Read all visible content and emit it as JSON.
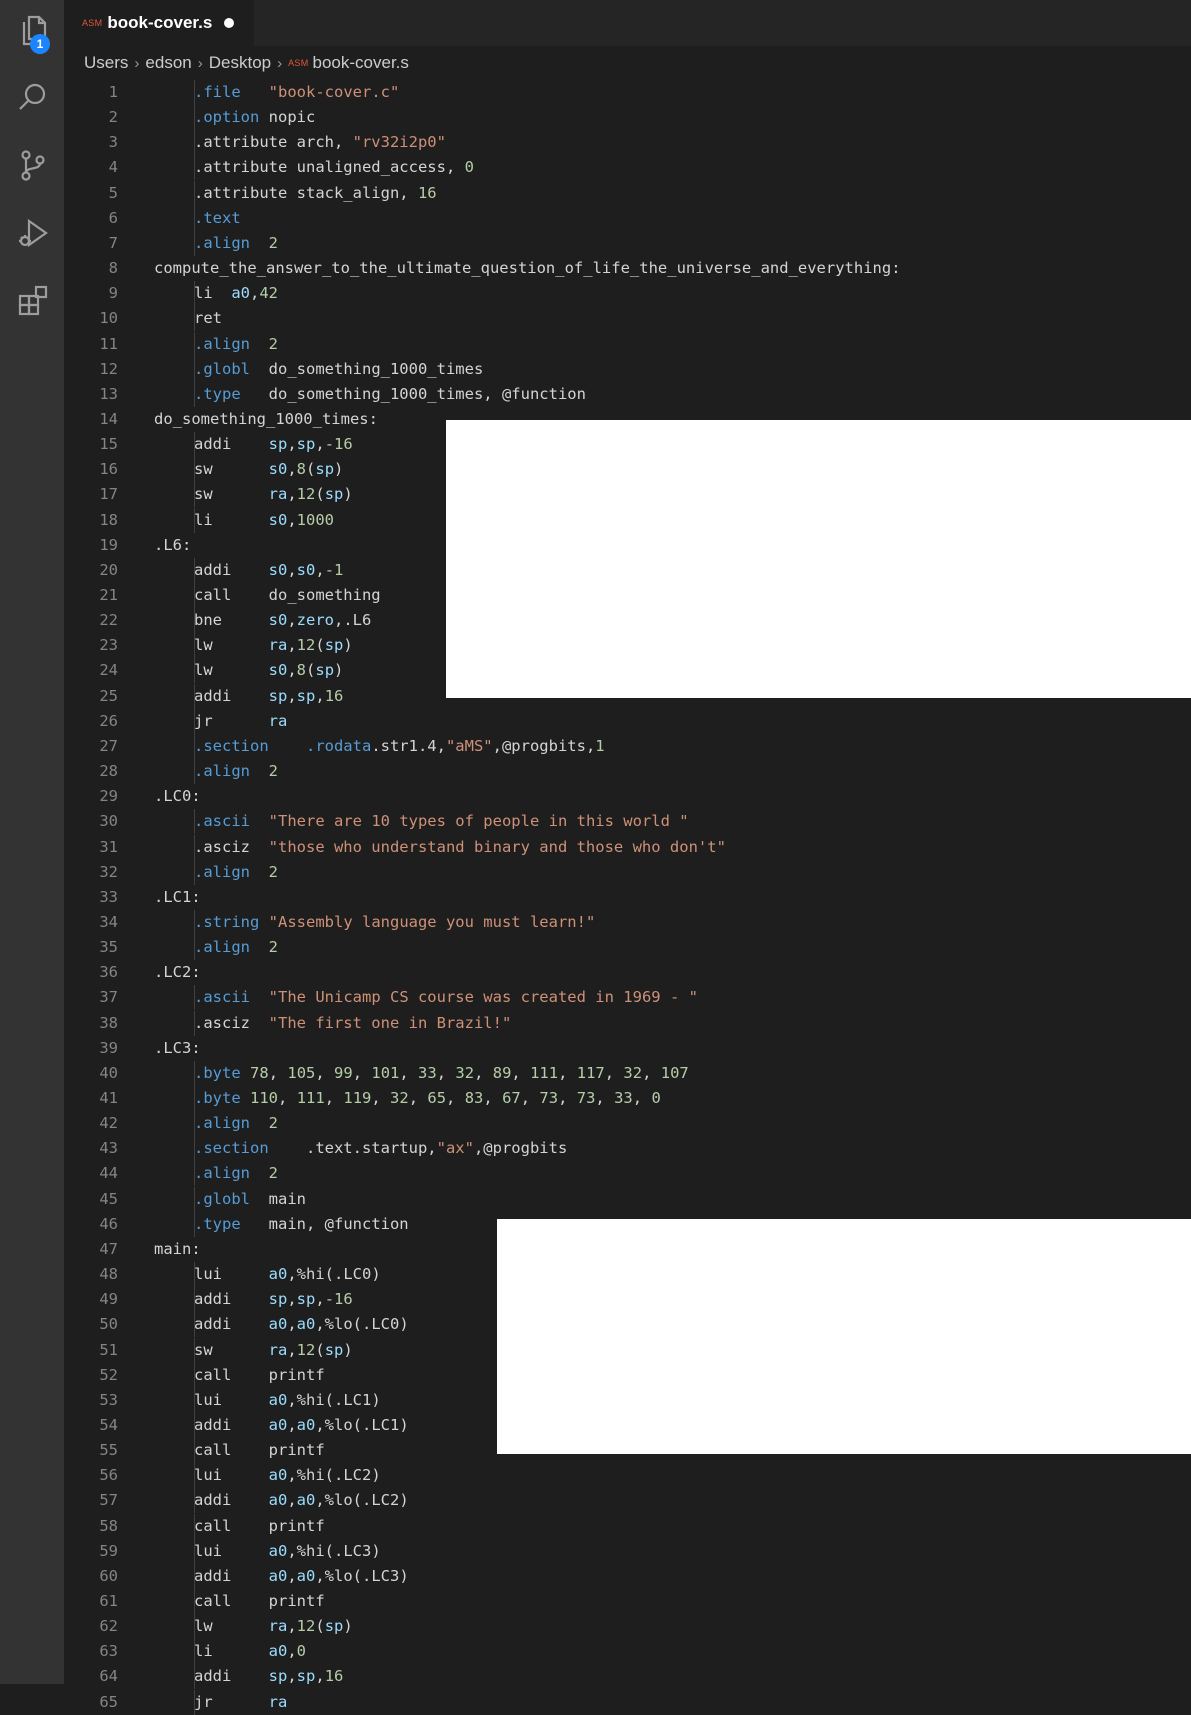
{
  "activity_bar": {
    "icons": [
      "files-icon",
      "search-icon",
      "source-control-icon",
      "run-debug-icon",
      "extensions-icon"
    ],
    "explorer_badge": "1"
  },
  "tab": {
    "language_badge": "ASM",
    "title": "book-cover.s",
    "dirty": true
  },
  "breadcrumb": [
    "Users",
    "edson",
    "Desktop",
    "book-cover.s"
  ],
  "colors": {
    "background": "#1e1e1e",
    "directive": "#569cd6",
    "string": "#ce9178",
    "number": "#b5cea8",
    "register": "#9cdcfe",
    "line_number": "#858585"
  },
  "lines": [
    {
      "n": "1",
      "i": 1,
      "tokens": [
        [
          ".file",
          "dir"
        ],
        [
          "   ",
          "txt"
        ],
        [
          "\"book-cover.c\"",
          "str"
        ]
      ]
    },
    {
      "n": "2",
      "i": 1,
      "tokens": [
        [
          ".option",
          "dir"
        ],
        [
          " nopic",
          "txt"
        ]
      ]
    },
    {
      "n": "3",
      "i": 1,
      "tokens": [
        [
          ".attribute arch, ",
          "txt"
        ],
        [
          "\"rv32i2p0\"",
          "str"
        ]
      ]
    },
    {
      "n": "4",
      "i": 1,
      "tokens": [
        [
          ".attribute unaligned_access, ",
          "txt"
        ],
        [
          "0",
          "num"
        ]
      ]
    },
    {
      "n": "5",
      "i": 1,
      "tokens": [
        [
          ".attribute stack_align, ",
          "txt"
        ],
        [
          "16",
          "num"
        ]
      ]
    },
    {
      "n": "6",
      "i": 1,
      "tokens": [
        [
          ".text",
          "dir"
        ]
      ]
    },
    {
      "n": "7",
      "i": 1,
      "tokens": [
        [
          ".align",
          "dir"
        ],
        [
          "  ",
          "txt"
        ],
        [
          "2",
          "num"
        ]
      ]
    },
    {
      "n": "8",
      "i": 0,
      "tokens": [
        [
          "compute_the_answer_to_the_ultimate_question_of_life_the_universe_and_everything:",
          "txt"
        ]
      ]
    },
    {
      "n": "9",
      "i": 1,
      "tokens": [
        [
          "li  ",
          "txt"
        ],
        [
          "a0",
          "reg"
        ],
        [
          ",",
          "txt"
        ],
        [
          "42",
          "num"
        ]
      ]
    },
    {
      "n": "10",
      "i": 1,
      "tokens": [
        [
          "ret",
          "txt"
        ]
      ]
    },
    {
      "n": "11",
      "i": 1,
      "tokens": [
        [
          ".align",
          "dir"
        ],
        [
          "  ",
          "txt"
        ],
        [
          "2",
          "num"
        ]
      ]
    },
    {
      "n": "12",
      "i": 1,
      "tokens": [
        [
          ".globl",
          "dir"
        ],
        [
          "  do_something_1000_times",
          "txt"
        ]
      ]
    },
    {
      "n": "13",
      "i": 1,
      "tokens": [
        [
          ".type",
          "dir"
        ],
        [
          "   do_something_1000_times, @function",
          "txt"
        ]
      ]
    },
    {
      "n": "14",
      "i": 0,
      "tokens": [
        [
          "do_something_1000_times:",
          "txt"
        ]
      ]
    },
    {
      "n": "15",
      "i": 1,
      "tokens": [
        [
          "addi    ",
          "txt"
        ],
        [
          "sp",
          "reg"
        ],
        [
          ",",
          "txt"
        ],
        [
          "sp",
          "reg"
        ],
        [
          ",",
          "txt"
        ],
        [
          "-16",
          "num"
        ]
      ]
    },
    {
      "n": "16",
      "i": 1,
      "tokens": [
        [
          "sw      ",
          "txt"
        ],
        [
          "s0",
          "reg"
        ],
        [
          ",",
          "txt"
        ],
        [
          "8",
          "num"
        ],
        [
          "(",
          "txt"
        ],
        [
          "sp",
          "reg"
        ],
        [
          ")",
          "txt"
        ]
      ]
    },
    {
      "n": "17",
      "i": 1,
      "tokens": [
        [
          "sw      ",
          "txt"
        ],
        [
          "ra",
          "reg"
        ],
        [
          ",",
          "txt"
        ],
        [
          "12",
          "num"
        ],
        [
          "(",
          "txt"
        ],
        [
          "sp",
          "reg"
        ],
        [
          ")",
          "txt"
        ]
      ]
    },
    {
      "n": "18",
      "i": 1,
      "tokens": [
        [
          "li      ",
          "txt"
        ],
        [
          "s0",
          "reg"
        ],
        [
          ",",
          "txt"
        ],
        [
          "1000",
          "num"
        ]
      ]
    },
    {
      "n": "19",
      "i": 0,
      "tokens": [
        [
          ".L6:",
          "txt"
        ]
      ]
    },
    {
      "n": "20",
      "i": 1,
      "tokens": [
        [
          "addi    ",
          "txt"
        ],
        [
          "s0",
          "reg"
        ],
        [
          ",",
          "txt"
        ],
        [
          "s0",
          "reg"
        ],
        [
          ",",
          "txt"
        ],
        [
          "-1",
          "num"
        ]
      ]
    },
    {
      "n": "21",
      "i": 1,
      "tokens": [
        [
          "call    do_something",
          "txt"
        ]
      ]
    },
    {
      "n": "22",
      "i": 1,
      "tokens": [
        [
          "bne     ",
          "txt"
        ],
        [
          "s0",
          "reg"
        ],
        [
          ",",
          "txt"
        ],
        [
          "zero",
          "reg"
        ],
        [
          ",.L6",
          "txt"
        ]
      ]
    },
    {
      "n": "23",
      "i": 1,
      "tokens": [
        [
          "lw      ",
          "txt"
        ],
        [
          "ra",
          "reg"
        ],
        [
          ",",
          "txt"
        ],
        [
          "12",
          "num"
        ],
        [
          "(",
          "txt"
        ],
        [
          "sp",
          "reg"
        ],
        [
          ")",
          "txt"
        ]
      ]
    },
    {
      "n": "24",
      "i": 1,
      "tokens": [
        [
          "lw      ",
          "txt"
        ],
        [
          "s0",
          "reg"
        ],
        [
          ",",
          "txt"
        ],
        [
          "8",
          "num"
        ],
        [
          "(",
          "txt"
        ],
        [
          "sp",
          "reg"
        ],
        [
          ")",
          "txt"
        ]
      ]
    },
    {
      "n": "25",
      "i": 1,
      "tokens": [
        [
          "addi    ",
          "txt"
        ],
        [
          "sp",
          "reg"
        ],
        [
          ",",
          "txt"
        ],
        [
          "sp",
          "reg"
        ],
        [
          ",",
          "txt"
        ],
        [
          "16",
          "num"
        ]
      ]
    },
    {
      "n": "26",
      "i": 1,
      "tokens": [
        [
          "jr      ",
          "txt"
        ],
        [
          "ra",
          "reg"
        ]
      ]
    },
    {
      "n": "27",
      "i": 1,
      "tokens": [
        [
          ".section",
          "dir"
        ],
        [
          "    ",
          "txt"
        ],
        [
          ".rodata",
          "dir"
        ],
        [
          ".str1.4,",
          "txt"
        ],
        [
          "\"aMS\"",
          "str"
        ],
        [
          ",@progbits,",
          "txt"
        ],
        [
          "1",
          "num"
        ]
      ]
    },
    {
      "n": "28",
      "i": 1,
      "tokens": [
        [
          ".align",
          "dir"
        ],
        [
          "  ",
          "txt"
        ],
        [
          "2",
          "num"
        ]
      ]
    },
    {
      "n": "29",
      "i": 0,
      "tokens": [
        [
          ".LC0:",
          "txt"
        ]
      ]
    },
    {
      "n": "30",
      "i": 1,
      "tokens": [
        [
          ".ascii",
          "dir"
        ],
        [
          "  ",
          "txt"
        ],
        [
          "\"There are 10 types of people in this world \"",
          "str"
        ]
      ]
    },
    {
      "n": "31",
      "i": 1,
      "tokens": [
        [
          ".asciz  ",
          "txt"
        ],
        [
          "\"those who understand binary and those who don't\"",
          "str"
        ]
      ]
    },
    {
      "n": "32",
      "i": 1,
      "tokens": [
        [
          ".align",
          "dir"
        ],
        [
          "  ",
          "txt"
        ],
        [
          "2",
          "num"
        ]
      ]
    },
    {
      "n": "33",
      "i": 0,
      "tokens": [
        [
          ".LC1:",
          "txt"
        ]
      ]
    },
    {
      "n": "34",
      "i": 1,
      "tokens": [
        [
          ".string",
          "dir"
        ],
        [
          " ",
          "txt"
        ],
        [
          "\"Assembly language you must learn!\"",
          "str"
        ]
      ]
    },
    {
      "n": "35",
      "i": 1,
      "tokens": [
        [
          ".align",
          "dir"
        ],
        [
          "  ",
          "txt"
        ],
        [
          "2",
          "num"
        ]
      ]
    },
    {
      "n": "36",
      "i": 0,
      "tokens": [
        [
          ".LC2:",
          "txt"
        ]
      ]
    },
    {
      "n": "37",
      "i": 1,
      "tokens": [
        [
          ".ascii",
          "dir"
        ],
        [
          "  ",
          "txt"
        ],
        [
          "\"The Unicamp CS course was created in 1969 - \"",
          "str"
        ]
      ]
    },
    {
      "n": "38",
      "i": 1,
      "tokens": [
        [
          ".asciz  ",
          "txt"
        ],
        [
          "\"The first one in Brazil!\"",
          "str"
        ]
      ]
    },
    {
      "n": "39",
      "i": 0,
      "tokens": [
        [
          ".LC3:",
          "txt"
        ]
      ]
    },
    {
      "n": "40",
      "i": 1,
      "tokens": [
        [
          ".byte",
          "dir"
        ],
        [
          " ",
          "txt"
        ],
        [
          "78",
          "num"
        ],
        [
          ", ",
          "txt"
        ],
        [
          "105",
          "num"
        ],
        [
          ", ",
          "txt"
        ],
        [
          "99",
          "num"
        ],
        [
          ", ",
          "txt"
        ],
        [
          "101",
          "num"
        ],
        [
          ", ",
          "txt"
        ],
        [
          "33",
          "num"
        ],
        [
          ", ",
          "txt"
        ],
        [
          "32",
          "num"
        ],
        [
          ", ",
          "txt"
        ],
        [
          "89",
          "num"
        ],
        [
          ", ",
          "txt"
        ],
        [
          "111",
          "num"
        ],
        [
          ", ",
          "txt"
        ],
        [
          "117",
          "num"
        ],
        [
          ", ",
          "txt"
        ],
        [
          "32",
          "num"
        ],
        [
          ", ",
          "txt"
        ],
        [
          "107",
          "num"
        ]
      ]
    },
    {
      "n": "41",
      "i": 1,
      "tokens": [
        [
          ".byte",
          "dir"
        ],
        [
          " ",
          "txt"
        ],
        [
          "110",
          "num"
        ],
        [
          ", ",
          "txt"
        ],
        [
          "111",
          "num"
        ],
        [
          ", ",
          "txt"
        ],
        [
          "119",
          "num"
        ],
        [
          ", ",
          "txt"
        ],
        [
          "32",
          "num"
        ],
        [
          ", ",
          "txt"
        ],
        [
          "65",
          "num"
        ],
        [
          ", ",
          "txt"
        ],
        [
          "83",
          "num"
        ],
        [
          ", ",
          "txt"
        ],
        [
          "67",
          "num"
        ],
        [
          ", ",
          "txt"
        ],
        [
          "73",
          "num"
        ],
        [
          ", ",
          "txt"
        ],
        [
          "73",
          "num"
        ],
        [
          ", ",
          "txt"
        ],
        [
          "33",
          "num"
        ],
        [
          ", ",
          "txt"
        ],
        [
          "0",
          "num"
        ]
      ]
    },
    {
      "n": "42",
      "i": 1,
      "tokens": [
        [
          ".align",
          "dir"
        ],
        [
          "  ",
          "txt"
        ],
        [
          "2",
          "num"
        ]
      ]
    },
    {
      "n": "43",
      "i": 1,
      "tokens": [
        [
          ".section",
          "dir"
        ],
        [
          "    .text.startup,",
          "txt"
        ],
        [
          "\"ax\"",
          "str"
        ],
        [
          ",@progbits",
          "txt"
        ]
      ]
    },
    {
      "n": "44",
      "i": 1,
      "tokens": [
        [
          ".align",
          "dir"
        ],
        [
          "  ",
          "txt"
        ],
        [
          "2",
          "num"
        ]
      ]
    },
    {
      "n": "45",
      "i": 1,
      "tokens": [
        [
          ".globl",
          "dir"
        ],
        [
          "  main",
          "txt"
        ]
      ]
    },
    {
      "n": "46",
      "i": 1,
      "tokens": [
        [
          ".type",
          "dir"
        ],
        [
          "   main, @function",
          "txt"
        ]
      ]
    },
    {
      "n": "47",
      "i": 0,
      "tokens": [
        [
          "main:",
          "txt"
        ]
      ]
    },
    {
      "n": "48",
      "i": 1,
      "tokens": [
        [
          "lui     ",
          "txt"
        ],
        [
          "a0",
          "reg"
        ],
        [
          ",%hi(.LC0)",
          "txt"
        ]
      ]
    },
    {
      "n": "49",
      "i": 1,
      "tokens": [
        [
          "addi    ",
          "txt"
        ],
        [
          "sp",
          "reg"
        ],
        [
          ",",
          "txt"
        ],
        [
          "sp",
          "reg"
        ],
        [
          ",",
          "txt"
        ],
        [
          "-16",
          "num"
        ]
      ]
    },
    {
      "n": "50",
      "i": 1,
      "tokens": [
        [
          "addi    ",
          "txt"
        ],
        [
          "a0",
          "reg"
        ],
        [
          ",",
          "txt"
        ],
        [
          "a0",
          "reg"
        ],
        [
          ",%lo(.LC0)",
          "txt"
        ]
      ]
    },
    {
      "n": "51",
      "i": 1,
      "tokens": [
        [
          "sw      ",
          "txt"
        ],
        [
          "ra",
          "reg"
        ],
        [
          ",",
          "txt"
        ],
        [
          "12",
          "num"
        ],
        [
          "(",
          "txt"
        ],
        [
          "sp",
          "reg"
        ],
        [
          ")",
          "txt"
        ]
      ]
    },
    {
      "n": "52",
      "i": 1,
      "tokens": [
        [
          "call    printf",
          "txt"
        ]
      ]
    },
    {
      "n": "53",
      "i": 1,
      "tokens": [
        [
          "lui     ",
          "txt"
        ],
        [
          "a0",
          "reg"
        ],
        [
          ",%hi(.LC1)",
          "txt"
        ]
      ]
    },
    {
      "n": "54",
      "i": 1,
      "tokens": [
        [
          "addi    ",
          "txt"
        ],
        [
          "a0",
          "reg"
        ],
        [
          ",",
          "txt"
        ],
        [
          "a0",
          "reg"
        ],
        [
          ",%lo(.LC1)",
          "txt"
        ]
      ]
    },
    {
      "n": "55",
      "i": 1,
      "tokens": [
        [
          "call    printf",
          "txt"
        ]
      ]
    },
    {
      "n": "56",
      "i": 1,
      "tokens": [
        [
          "lui     ",
          "txt"
        ],
        [
          "a0",
          "reg"
        ],
        [
          ",%hi(.LC2)",
          "txt"
        ]
      ]
    },
    {
      "n": "57",
      "i": 1,
      "tokens": [
        [
          "addi    ",
          "txt"
        ],
        [
          "a0",
          "reg"
        ],
        [
          ",",
          "txt"
        ],
        [
          "a0",
          "reg"
        ],
        [
          ",%lo(.LC2)",
          "txt"
        ]
      ]
    },
    {
      "n": "58",
      "i": 1,
      "tokens": [
        [
          "call    printf",
          "txt"
        ]
      ]
    },
    {
      "n": "59",
      "i": 1,
      "tokens": [
        [
          "lui     ",
          "txt"
        ],
        [
          "a0",
          "reg"
        ],
        [
          ",%hi(.LC3)",
          "txt"
        ]
      ]
    },
    {
      "n": "60",
      "i": 1,
      "tokens": [
        [
          "addi    ",
          "txt"
        ],
        [
          "a0",
          "reg"
        ],
        [
          ",",
          "txt"
        ],
        [
          "a0",
          "reg"
        ],
        [
          ",%lo(.LC3)",
          "txt"
        ]
      ]
    },
    {
      "n": "61",
      "i": 1,
      "tokens": [
        [
          "call    printf",
          "txt"
        ]
      ]
    },
    {
      "n": "62",
      "i": 1,
      "tokens": [
        [
          "lw      ",
          "txt"
        ],
        [
          "ra",
          "reg"
        ],
        [
          ",",
          "txt"
        ],
        [
          "12",
          "num"
        ],
        [
          "(",
          "txt"
        ],
        [
          "sp",
          "reg"
        ],
        [
          ")",
          "txt"
        ]
      ]
    },
    {
      "n": "63",
      "i": 1,
      "tokens": [
        [
          "li      ",
          "txt"
        ],
        [
          "a0",
          "reg"
        ],
        [
          ",",
          "txt"
        ],
        [
          "0",
          "num"
        ]
      ]
    },
    {
      "n": "64",
      "i": 1,
      "tokens": [
        [
          "addi    ",
          "txt"
        ],
        [
          "sp",
          "reg"
        ],
        [
          ",",
          "txt"
        ],
        [
          "sp",
          "reg"
        ],
        [
          ",",
          "txt"
        ],
        [
          "16",
          "num"
        ]
      ]
    },
    {
      "n": "65",
      "i": 1,
      "tokens": [
        [
          "jr      ",
          "txt"
        ],
        [
          "ra",
          "reg"
        ]
      ]
    }
  ]
}
